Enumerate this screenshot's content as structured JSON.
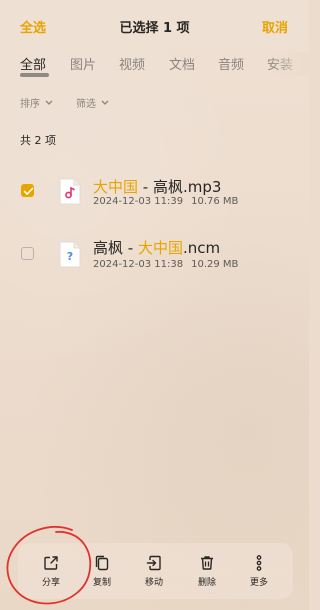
{
  "header": {
    "select_all": "全选",
    "title": "已选择 1 项",
    "cancel": "取消"
  },
  "tabs": [
    {
      "label": "全部",
      "active": true
    },
    {
      "label": "图片",
      "active": false
    },
    {
      "label": "视频",
      "active": false
    },
    {
      "label": "文档",
      "active": false
    },
    {
      "label": "音频",
      "active": false
    },
    {
      "label": "安装",
      "active": false
    }
  ],
  "filters": {
    "sort": "排序",
    "filter": "筛选"
  },
  "count_text": "共 2 项",
  "files": [
    {
      "checked": true,
      "icon": "audio-file-icon",
      "name_parts": [
        {
          "text": "大中国",
          "highlight": true
        },
        {
          "text": " - 高枫.mp3",
          "highlight": false
        }
      ],
      "date": "2024-12-03 11:39",
      "size": "10.76 MB"
    },
    {
      "checked": false,
      "icon": "unknown-file-icon",
      "name_parts": [
        {
          "text": "高枫 - ",
          "highlight": false
        },
        {
          "text": "大中国",
          "highlight": true
        },
        {
          "text": ".ncm",
          "highlight": false
        }
      ],
      "date": "2024-12-03 11:38",
      "size": "10.29 MB"
    }
  ],
  "toolbar": [
    {
      "label": "分享",
      "icon": "share-icon"
    },
    {
      "label": "复制",
      "icon": "copy-icon"
    },
    {
      "label": "移动",
      "icon": "move-icon"
    },
    {
      "label": "删除",
      "icon": "delete-icon"
    },
    {
      "label": "更多",
      "icon": "more-icon"
    }
  ],
  "colors": {
    "accent": "#e8a400",
    "background": "#ecdccd",
    "annotation": "#e1332d"
  }
}
